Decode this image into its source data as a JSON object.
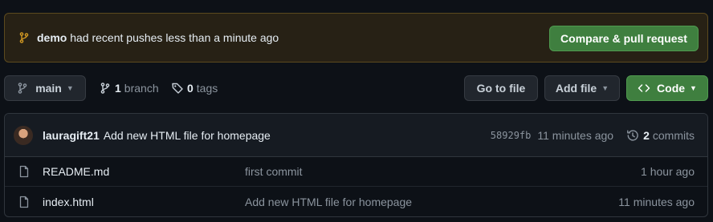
{
  "banner": {
    "branch": "demo",
    "message": "had recent pushes less than a minute ago",
    "compare_label": "Compare & pull request"
  },
  "toolbar": {
    "branch_label": "main",
    "branch_count": "1",
    "branch_word": "branch",
    "tag_count": "0",
    "tag_word": "tags",
    "go_to_file_label": "Go to file",
    "add_file_label": "Add file",
    "code_label": "Code"
  },
  "latest_commit": {
    "author": "lauragift21",
    "message": "Add new HTML file for homepage",
    "sha": "58929fb",
    "time": "11 minutes ago",
    "commit_count": "2",
    "commit_word": "commits"
  },
  "files": [
    {
      "name": "README.md",
      "commit_message": "first commit",
      "age": "1 hour ago"
    },
    {
      "name": "index.html",
      "commit_message": "Add new HTML file for homepage",
      "age": "11 minutes ago"
    }
  ],
  "colors": {
    "background": "#0d1117",
    "primary_button": "#3f7f3f",
    "banner_bg": "#272115",
    "warning_icon": "#d29922"
  }
}
